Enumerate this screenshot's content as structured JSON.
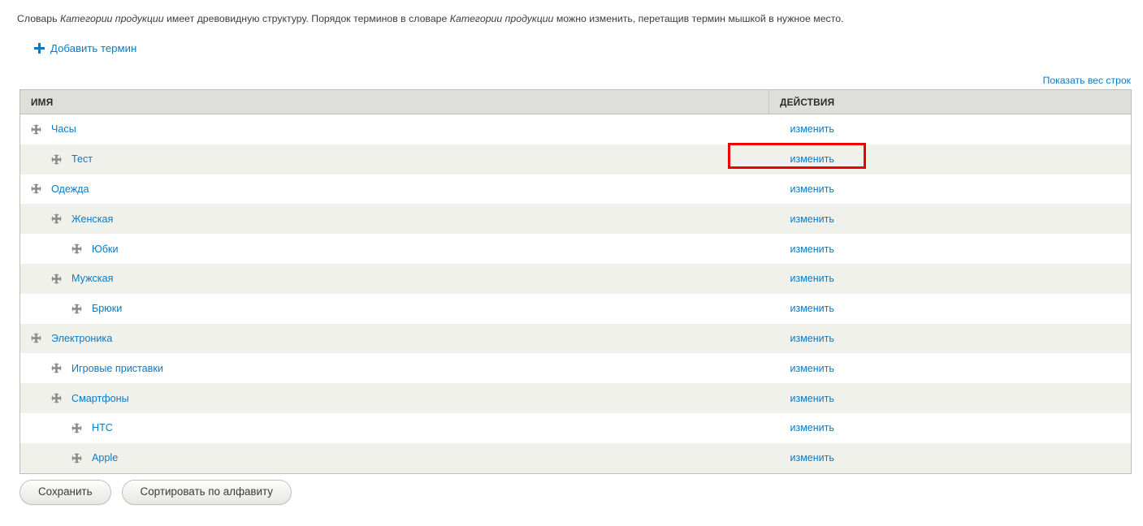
{
  "intro": {
    "part1": "Словарь ",
    "vocab1": "Категории продукции",
    "part2": " имеет древовидную структуру. Порядок терминов в словаре ",
    "vocab2": "Категории продукции",
    "part3": " можно изменить, перетащив термин мышкой в нужное место."
  },
  "actions": {
    "add_term_label": "Добавить термин",
    "add_term_icon": "plus-icon",
    "show_weights_label": "Показать вес строк"
  },
  "table": {
    "headers": {
      "name": "ИМЯ",
      "actions": "ДЕЙСТВИЯ"
    },
    "edit_label": "изменить",
    "drag_icon": "move-cross-icon",
    "rows": [
      {
        "name": "Часы",
        "level": 0,
        "edit": "изменить"
      },
      {
        "name": "Тест",
        "level": 1,
        "edit": "изменить"
      },
      {
        "name": "Одежда",
        "level": 0,
        "edit": "изменить"
      },
      {
        "name": "Женская",
        "level": 1,
        "edit": "изменить"
      },
      {
        "name": "Юбки",
        "level": 2,
        "edit": "изменить"
      },
      {
        "name": "Мужская",
        "level": 1,
        "edit": "изменить"
      },
      {
        "name": "Брюки",
        "level": 2,
        "edit": "изменить"
      },
      {
        "name": "Электроника",
        "level": 0,
        "edit": "изменить"
      },
      {
        "name": "Игровые приставки",
        "level": 1,
        "edit": "изменить"
      },
      {
        "name": "Смартфоны",
        "level": 1,
        "edit": "изменить"
      },
      {
        "name": "HTC",
        "level": 2,
        "edit": "изменить"
      },
      {
        "name": "Apple",
        "level": 2,
        "edit": "изменить"
      }
    ]
  },
  "footer": {
    "save_label": "Сохранить",
    "sort_label": "Сортировать по алфавиту"
  },
  "highlight": {
    "target_row_index": 1,
    "target": "изменить",
    "color": "#ee0000"
  },
  "colors": {
    "link": "#0b7ac4",
    "header_bg": "#dededa",
    "stripe_bg": "#f1f1ec",
    "border": "#bebeb4",
    "text": "#3b3b3b"
  }
}
